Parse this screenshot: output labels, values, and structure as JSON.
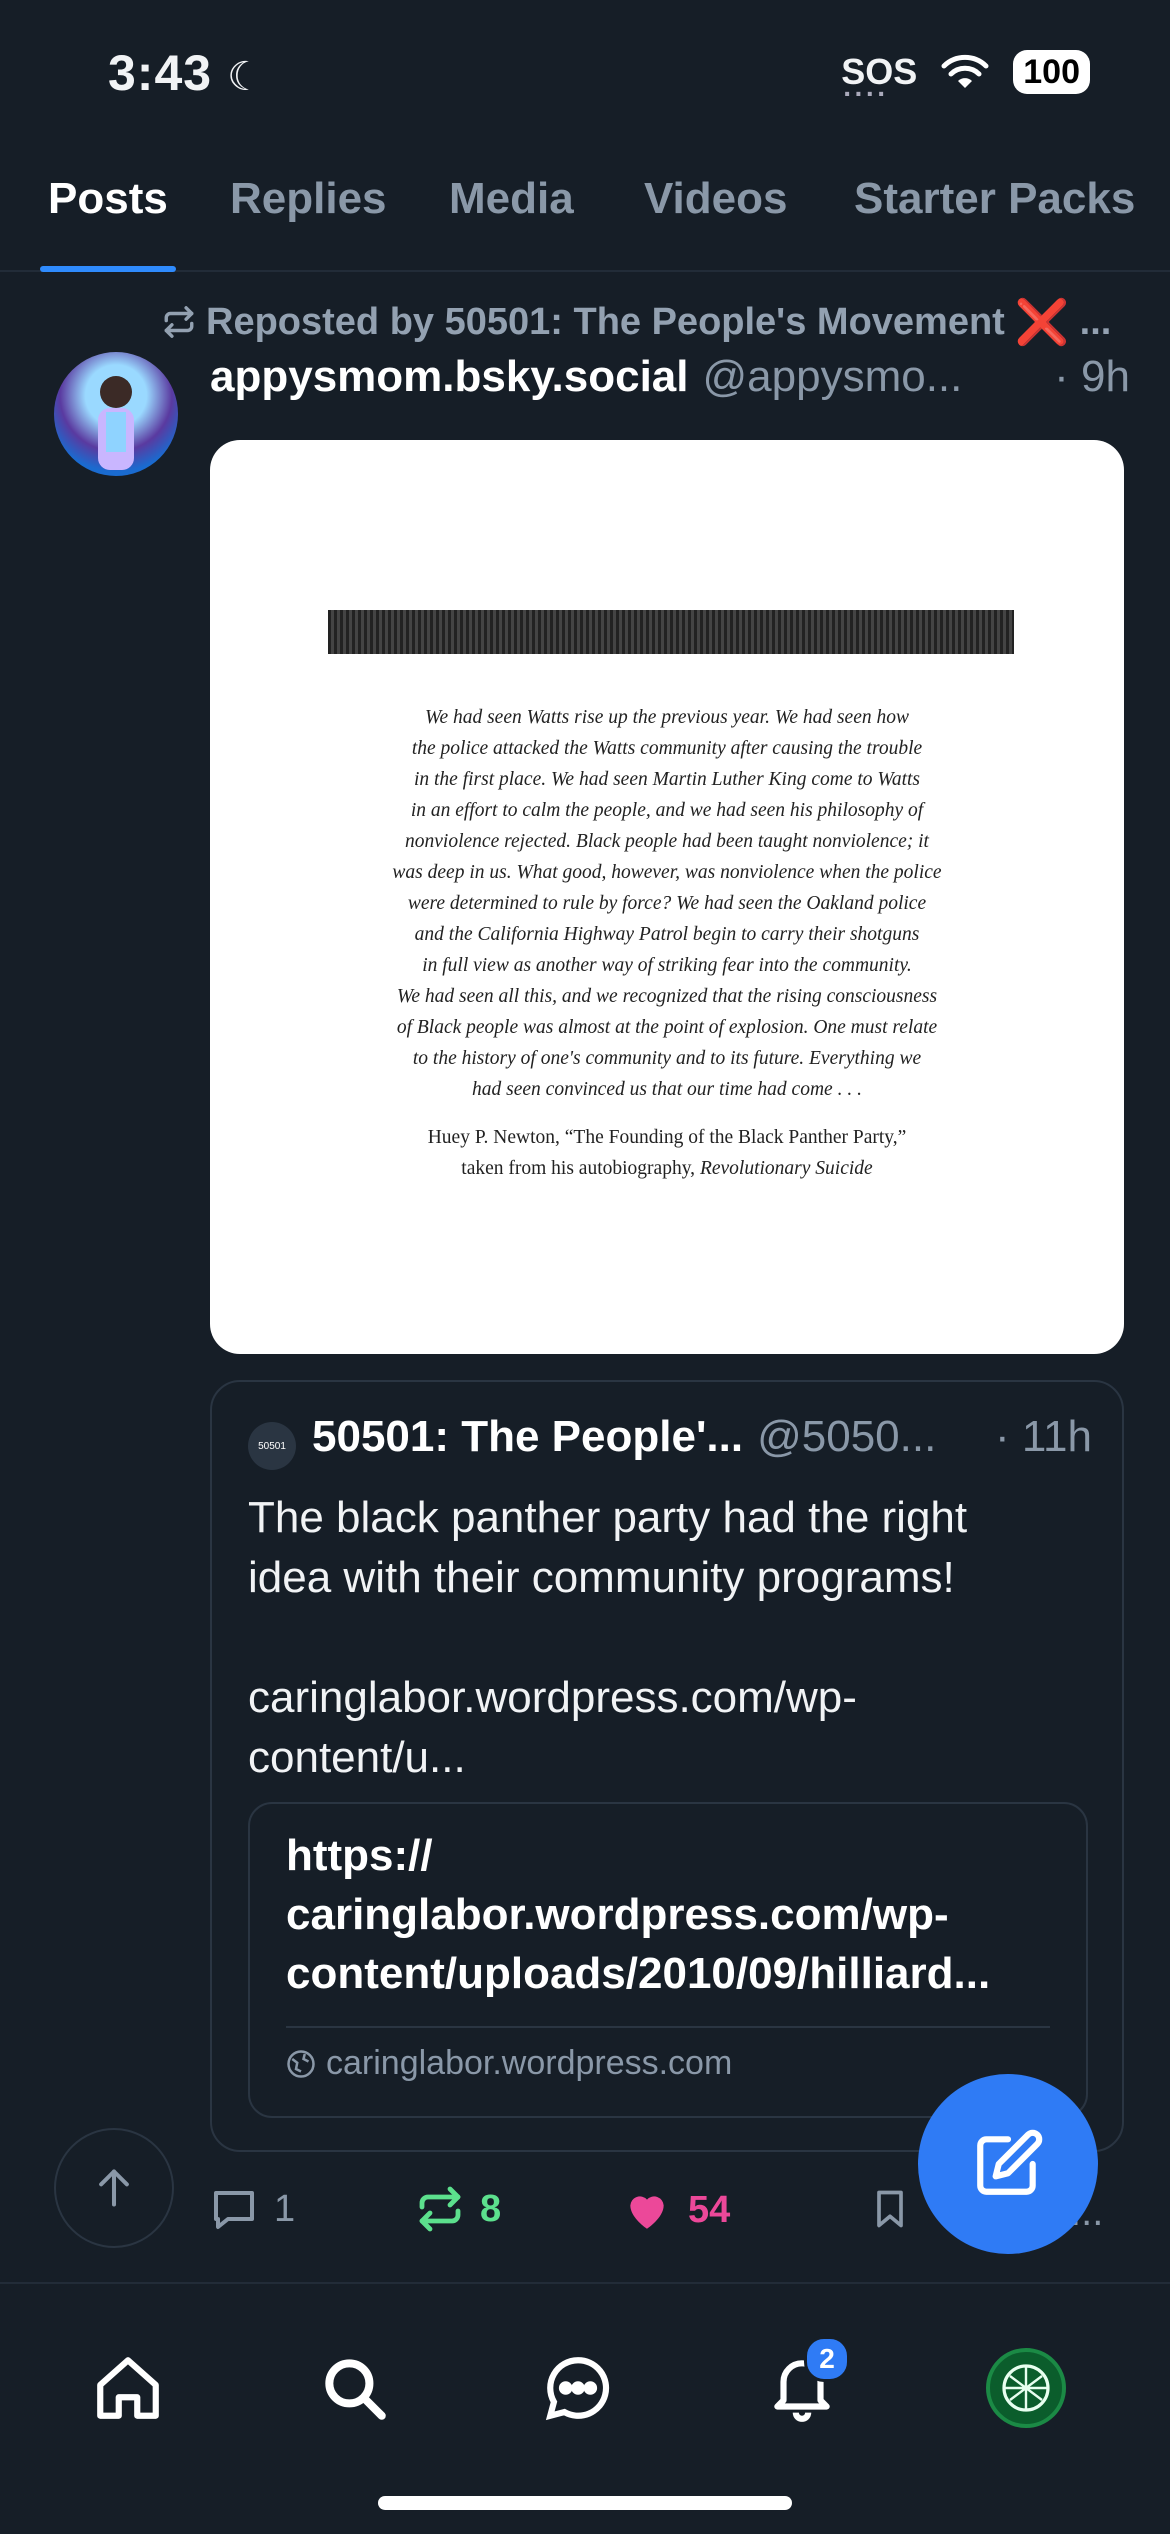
{
  "status_bar": {
    "time": "3:43",
    "sos": "SOS",
    "battery": "100"
  },
  "tabs": [
    {
      "label": "Posts"
    },
    {
      "label": "Replies"
    },
    {
      "label": "Media"
    },
    {
      "label": "Videos"
    },
    {
      "label": "Starter Packs"
    }
  ],
  "post": {
    "repost_text": "Reposted by 50501: The People's Movement",
    "repost_emoji": "❌",
    "repost_more": "...",
    "author": "appysmom.bsky.social",
    "handle": "@appysmo...",
    "time": "· 9h",
    "image_quote": "We had seen Watts rise up the previous year. We had seen how\nthe police attacked the Watts community after causing the trouble\nin the first place. We had seen Martin Luther King come to Watts\nin an effort to calm the people, and we had seen his philosophy of\nnonviolence rejected. Black people had been taught nonviolence; it\nwas deep in us. What good, however, was nonviolence when the police\nwere determined to rule by force? We had seen the Oakland police\nand the California Highway Patrol begin to carry their shotguns\nin full view as another way of striking fear into the community.\nWe had seen all this, and we recognized that the rising consciousness\nof Black people was almost at the point of explosion. One must relate\nto the history of one's community and to its future. Everything we\nhad seen convinced us that our time had come . . .",
    "image_attribution_line1": "Huey P. Newton, “The Founding of the Black Panther Party,”",
    "image_attribution_line2": "taken from his autobiography,",
    "image_attribution_book": "Revolutionary Suicide",
    "quoted": {
      "avatar_text": "50501",
      "author": "50501: The People'...",
      "handle": "@5050...",
      "time": "· 11h",
      "text": "The black panther party had the right\nidea with their community programs!\n\ncaringlabor.wordpress.com/wp-\ncontent/u...",
      "link_title": "https://\ncaringlabor.wordpress.com/wp-\ncontent/uploads/2010/09/hilliard...",
      "link_domain": "caringlabor.wordpress.com"
    },
    "actions": {
      "replies": "1",
      "reposts": "8",
      "likes": "54",
      "more": "..."
    }
  },
  "bottom_nav": {
    "notifications_badge": "2"
  },
  "colors": {
    "accent": "#2f8bfd",
    "repost": "#5ce08d",
    "like": "#ec4899",
    "background": "#161e27"
  }
}
